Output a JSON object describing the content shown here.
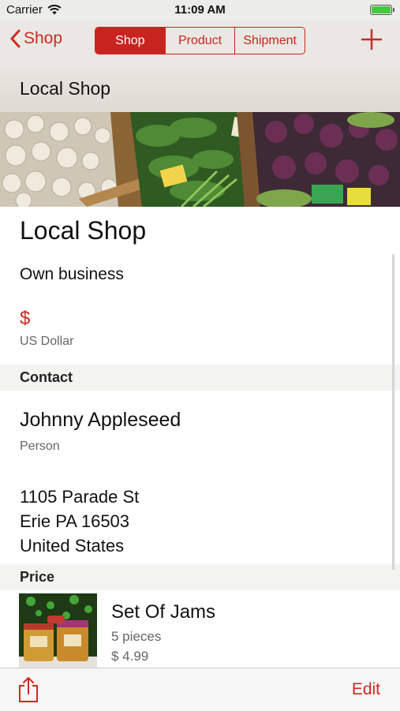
{
  "status_bar": {
    "carrier": "Carrier",
    "time": "11:09 AM",
    "battery_level": 1.0
  },
  "nav": {
    "back_label": "Shop",
    "segments": [
      {
        "label": "Shop",
        "active": true
      },
      {
        "label": "Product",
        "active": false
      },
      {
        "label": "Shipment",
        "active": false
      }
    ],
    "add_icon": "plus-icon"
  },
  "header_title": "Local Shop",
  "shop": {
    "name": "Local Shop",
    "type": "Own business",
    "currency_symbol": "$",
    "currency_name": "US Dollar"
  },
  "contact": {
    "section_label": "Contact",
    "name": "Johnny Appleseed",
    "role": "Person",
    "address": [
      "1105 Parade St",
      "Erie PA 16503",
      "United States"
    ]
  },
  "price": {
    "section_label": "Price",
    "product": {
      "name": "Set Of Jams",
      "quantity": "5 pieces",
      "price": "$ 4.99"
    }
  },
  "toolbar": {
    "share_icon": "share-icon",
    "edit_label": "Edit"
  },
  "colors": {
    "accent": "#cc2a22"
  }
}
